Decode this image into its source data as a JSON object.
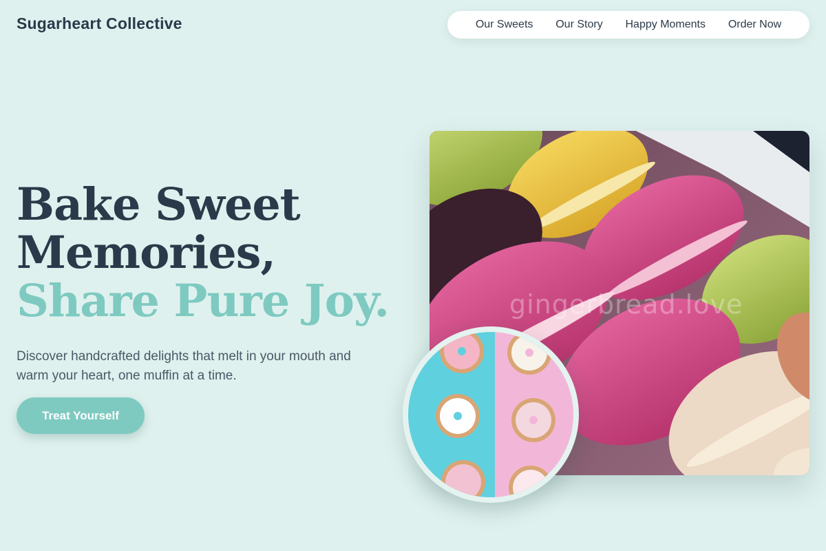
{
  "brand": {
    "name": "Sugarheart Collective"
  },
  "nav": {
    "items": [
      {
        "label": "Our Sweets"
      },
      {
        "label": "Our Story"
      },
      {
        "label": "Happy Moments"
      },
      {
        "label": "Order Now"
      }
    ]
  },
  "hero": {
    "title_line1": "Bake Sweet",
    "title_line2": "Memories,",
    "title_accent": "Share Pure Joy.",
    "description": "Discover handcrafted delights that melt in your mouth and warm your heart, one muffin at a time.",
    "cta_label": "Treat Yourself"
  },
  "images": {
    "main": {
      "subject": "macarons-photo",
      "watermark": "gingerbread.love"
    },
    "circle": {
      "subject": "donuts-photo"
    }
  },
  "colors": {
    "background": "#dff1ee",
    "accent": "#7ecac1",
    "text_dark": "#2b3a4a",
    "nav_bg": "#ffffff"
  }
}
